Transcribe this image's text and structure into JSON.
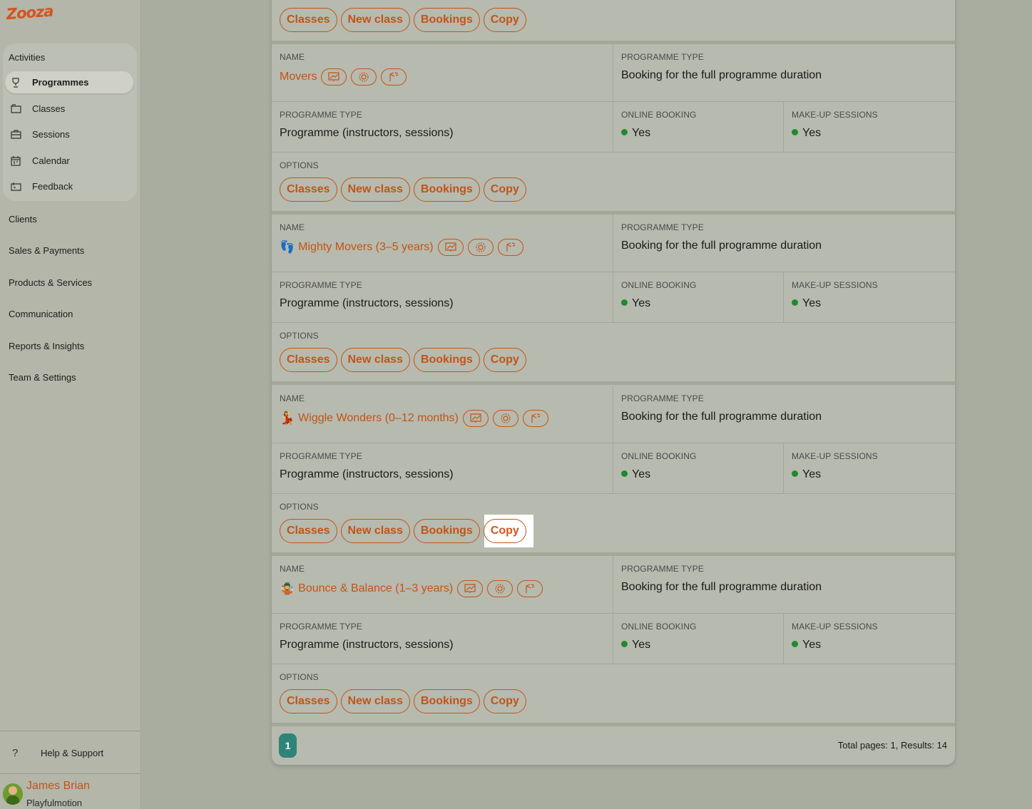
{
  "brand": {
    "logo_text": "Zooza"
  },
  "sidebar": {
    "group_title": "Activities",
    "group_items": [
      {
        "label": "Programmes",
        "icon": "trophy-icon",
        "active": true
      },
      {
        "label": "Classes",
        "icon": "folder-icon",
        "active": false
      },
      {
        "label": "Sessions",
        "icon": "briefcase-icon",
        "active": false
      },
      {
        "label": "Calendar",
        "icon": "calendar-icon",
        "active": false
      },
      {
        "label": "Feedback",
        "icon": "feedback-icon",
        "active": false
      }
    ],
    "items": [
      {
        "label": "Clients"
      },
      {
        "label": "Sales & Payments"
      },
      {
        "label": "Products & Services"
      },
      {
        "label": "Communication"
      },
      {
        "label": "Reports & Insights"
      },
      {
        "label": "Team & Settings"
      }
    ],
    "help": {
      "icon": "?",
      "label": "Help & Support"
    },
    "user": {
      "name": "James Brian",
      "org": "Playfulmotion"
    }
  },
  "labels": {
    "name": "NAME",
    "programme_type": "PROGRAMME TYPE",
    "online_booking": "ONLINE BOOKING",
    "makeup_sessions": "MAKE-UP SESSIONS",
    "options": "OPTIONS"
  },
  "option_buttons": {
    "classes": "Classes",
    "new_class": "New class",
    "bookings": "Bookings",
    "copy": "Copy"
  },
  "programmes": [
    {
      "name": "Movers",
      "emoji": "",
      "booking_type": "Booking for the full programme duration",
      "programme_type": "Programme (instructors, sessions)",
      "online_booking": "Yes",
      "makeup_sessions": "Yes"
    },
    {
      "name": "Mighty Movers (3–5 years)",
      "emoji": "👣",
      "booking_type": "Booking for the full programme duration",
      "programme_type": "Programme (instructors, sessions)",
      "online_booking": "Yes",
      "makeup_sessions": "Yes"
    },
    {
      "name": "Wiggle Wonders (0–12 months)",
      "emoji": "💃",
      "booking_type": "Booking for the full programme duration",
      "programme_type": "Programme (instructors, sessions)",
      "online_booking": "Yes",
      "makeup_sessions": "Yes"
    },
    {
      "name": "Bounce & Balance (1–3 years)",
      "emoji": "🤹",
      "booking_type": "Booking for the full programme duration",
      "programme_type": "Programme (instructors, sessions)",
      "online_booking": "Yes",
      "makeup_sessions": "Yes"
    }
  ],
  "pagination": {
    "current": "1",
    "totals": "Total pages: 1, Results: 14"
  },
  "colors": {
    "accent": "#c25418",
    "status_green": "#1e8a2e",
    "pager": "#2f8478"
  }
}
